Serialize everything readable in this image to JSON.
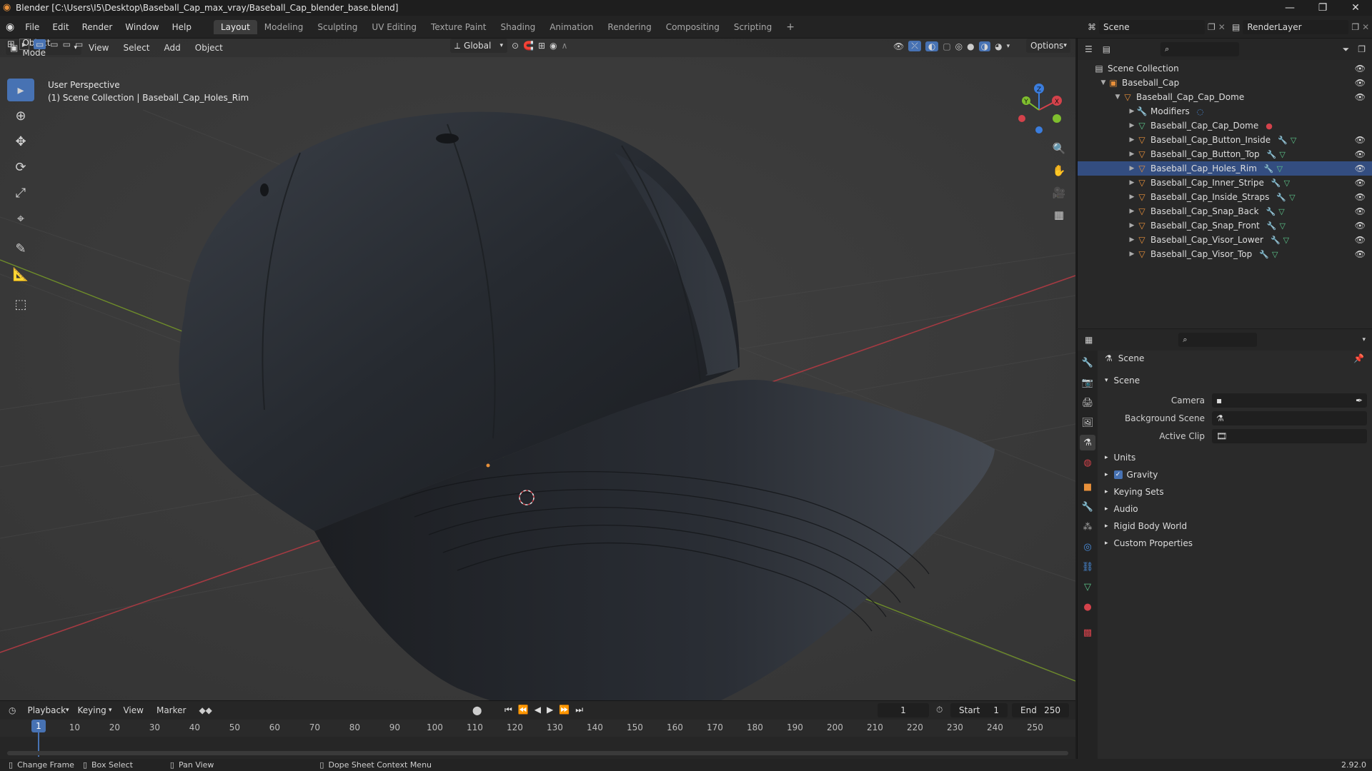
{
  "window": {
    "title": "Blender [C:\\Users\\I5\\Desktop\\Baseball_Cap_max_vray/Baseball_Cap_blender_base.blend]",
    "controls": [
      "—",
      "❐",
      "✕"
    ]
  },
  "menubar": {
    "menus": [
      "File",
      "Edit",
      "Render",
      "Window",
      "Help"
    ],
    "workspaces": [
      "Layout",
      "Modeling",
      "Sculpting",
      "UV Editing",
      "Texture Paint",
      "Shading",
      "Animation",
      "Rendering",
      "Compositing",
      "Scripting"
    ],
    "active_workspace": "Layout",
    "add_tab": "+",
    "scene_label": "Scene",
    "render_layer_label": "RenderLayer"
  },
  "view3d_header": {
    "transform_orientation": "Global",
    "options_label": "Options",
    "mode": "Object Mode",
    "menus": [
      "View",
      "Select",
      "Add",
      "Object"
    ]
  },
  "viewport": {
    "perspective_label": "User Perspective",
    "collection_label": "(1) Scene Collection | Baseball_Cap_Holes_Rim",
    "gizmo_axes": {
      "x": "X",
      "y": "Y",
      "z": "Z"
    }
  },
  "outliner": {
    "root": "Scene Collection",
    "rows": [
      {
        "label": "Baseball_Cap",
        "depth": 1,
        "icon": "collection-icon",
        "expanded": true
      },
      {
        "label": "Baseball_Cap_Cap_Dome",
        "depth": 2,
        "icon": "object-icon",
        "expanded": true
      },
      {
        "label": "Modifiers",
        "depth": 3,
        "icon": "wrench-icon",
        "expanded": false
      },
      {
        "label": "Baseball_Cap_Cap_Dome",
        "depth": 3,
        "icon": "mesh-icon",
        "expanded": false
      },
      {
        "label": "Baseball_Cap_Button_Inside",
        "depth": 3,
        "icon": "object-icon",
        "expanded": false
      },
      {
        "label": "Baseball_Cap_Button_Top",
        "depth": 3,
        "icon": "object-icon",
        "expanded": false
      },
      {
        "label": "Baseball_Cap_Holes_Rim",
        "depth": 3,
        "icon": "object-icon",
        "expanded": false,
        "selected": true
      },
      {
        "label": "Baseball_Cap_Inner_Stripe",
        "depth": 3,
        "icon": "object-icon",
        "expanded": false
      },
      {
        "label": "Baseball_Cap_Inside_Straps",
        "depth": 3,
        "icon": "object-icon",
        "expanded": false
      },
      {
        "label": "Baseball_Cap_Snap_Back",
        "depth": 3,
        "icon": "object-icon",
        "expanded": false
      },
      {
        "label": "Baseball_Cap_Snap_Front",
        "depth": 3,
        "icon": "object-icon",
        "expanded": false
      },
      {
        "label": "Baseball_Cap_Visor_Lower",
        "depth": 3,
        "icon": "object-icon",
        "expanded": false
      },
      {
        "label": "Baseball_Cap_Visor_Top",
        "depth": 3,
        "icon": "object-icon",
        "expanded": false
      }
    ]
  },
  "properties": {
    "context": "Scene",
    "panel_title": "Scene",
    "fields": [
      {
        "label": "Camera",
        "value": ""
      },
      {
        "label": "Background Scene",
        "value": ""
      },
      {
        "label": "Active Clip",
        "value": ""
      }
    ],
    "subpanels": [
      "Units",
      "Gravity",
      "Keying Sets",
      "Audio",
      "Rigid Body World",
      "Custom Properties"
    ],
    "gravity_checked": true
  },
  "timeline": {
    "menus": [
      "Playback",
      "Keying",
      "View",
      "Marker"
    ],
    "current_frame": "1",
    "start_label": "Start",
    "start_value": "1",
    "end_label": "End",
    "end_value": "250",
    "ticks": [
      "1",
      "10",
      "20",
      "30",
      "40",
      "50",
      "60",
      "70",
      "80",
      "90",
      "100",
      "110",
      "120",
      "130",
      "140",
      "150",
      "160",
      "170",
      "180",
      "190",
      "200",
      "210",
      "220",
      "230",
      "240",
      "250"
    ]
  },
  "statusbar": {
    "items": [
      "Change Frame",
      "Box Select",
      "Pan View",
      "Dope Sheet Context Menu"
    ],
    "version": "2.92.0"
  },
  "colors": {
    "accent": "#4772b3",
    "object_orange": "#e8903a",
    "mesh_green": "#5cc48a",
    "x_axis": "#d4424b",
    "y_axis": "#7fbe2e",
    "z_axis": "#3b7ddd"
  }
}
